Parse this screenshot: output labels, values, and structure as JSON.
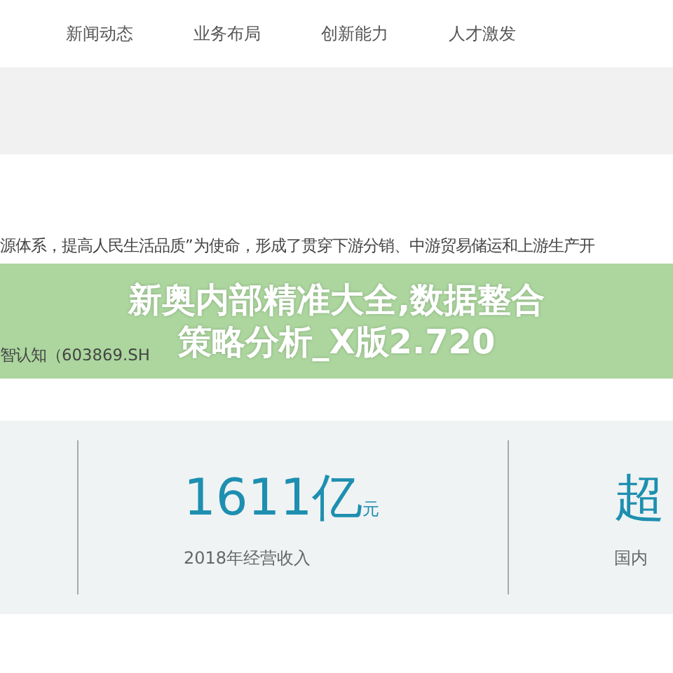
{
  "nav": {
    "items": [
      {
        "label": "新闻动态"
      },
      {
        "label": "业务布局"
      },
      {
        "label": "创新能力"
      },
      {
        "label": "人才激发"
      }
    ]
  },
  "intro": {
    "lines": [
      "源体系，提高人民生活品质”为使命，形成了贯穿下游分销、中游贸易储运和上游生产开",
      "智认知（603869.SH"
    ]
  },
  "banner": {
    "lines": [
      "新奥内部精准大全,数据整合",
      "策略分析_X版2.720"
    ]
  },
  "stats": [
    {
      "value": "1611亿",
      "unit": "元",
      "caption": "2018年经营收入"
    },
    {
      "value": "超",
      "caption": "国内"
    }
  ]
}
